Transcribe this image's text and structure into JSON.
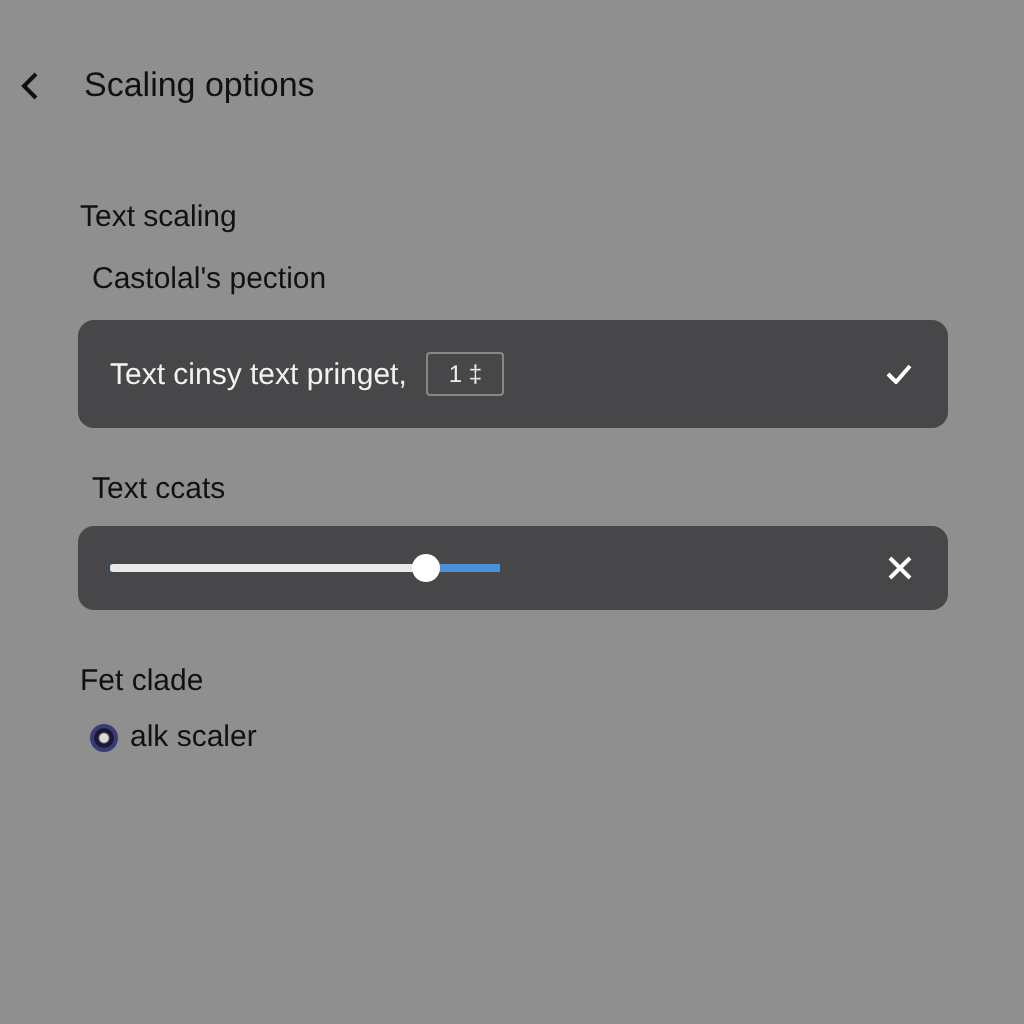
{
  "header": {
    "title": "Scaling options"
  },
  "section_title": "Text scaling",
  "subtitle": "Castolal's pection",
  "option_row": {
    "label": "Text cinsy text pringet,",
    "value": "1 ‡",
    "checked": true
  },
  "slider_label": "Text ccats",
  "slider": {
    "level": 0.81
  },
  "radio_section": "Fet clade",
  "radio": {
    "label": "alk scaler",
    "selected": true
  }
}
